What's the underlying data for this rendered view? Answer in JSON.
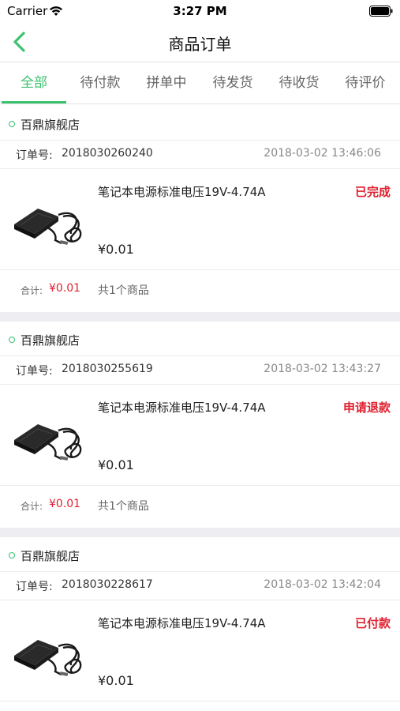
{
  "status_bar": {
    "carrier": "Carrier",
    "time": "3:27 PM"
  },
  "nav": {
    "title": "商品订单"
  },
  "tabs": [
    {
      "label": "全部",
      "active": true
    },
    {
      "label": "待付款",
      "active": false
    },
    {
      "label": "拼单中",
      "active": false
    },
    {
      "label": "待发货",
      "active": false
    },
    {
      "label": "待收货",
      "active": false
    },
    {
      "label": "待评价",
      "active": false
    }
  ],
  "colors": {
    "accent": "#3cc26f",
    "status": "#e0202f"
  },
  "order_no_label": "订单号:",
  "total_label": "合计:",
  "orders": [
    {
      "store": "百鼎旗舰店",
      "order_no": "2018030260240",
      "time": "2018-03-02 13:46:06",
      "product_name": "笔记本电源标准电压19V-4.74A",
      "status": "已完成",
      "price": "¥0.01",
      "total": "¥0.01",
      "count_text": "共1个商品"
    },
    {
      "store": "百鼎旗舰店",
      "order_no": "2018030255619",
      "time": "2018-03-02 13:43:27",
      "product_name": "笔记本电源标准电压19V-4.74A",
      "status": "申请退款",
      "price": "¥0.01",
      "total": "¥0.01",
      "count_text": "共1个商品"
    },
    {
      "store": "百鼎旗舰店",
      "order_no": "2018030228617",
      "time": "2018-03-02 13:42:04",
      "product_name": "笔记本电源标准电压19V-4.74A",
      "status": "已付款",
      "price": "¥0.01",
      "total": "",
      "count_text": ""
    }
  ]
}
